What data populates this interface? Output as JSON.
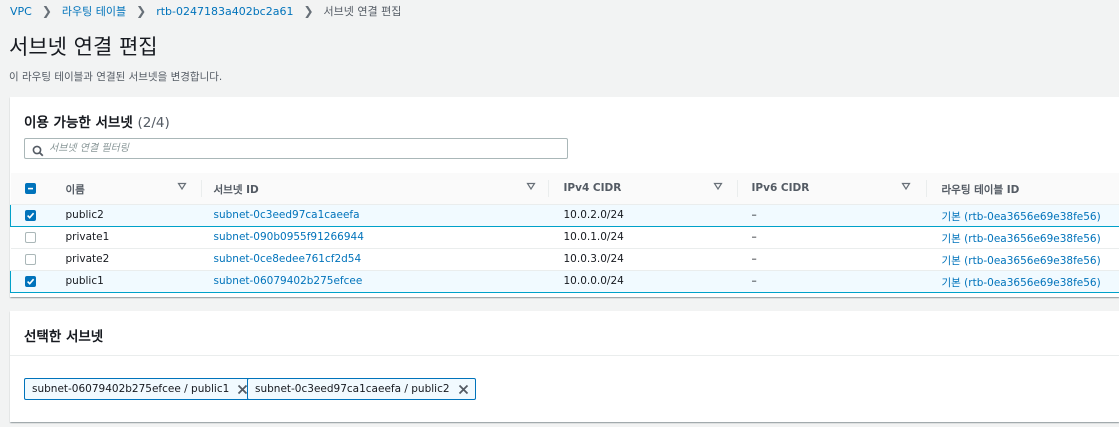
{
  "breadcrumb": {
    "items": [
      "VPC",
      "라우팅 테이블",
      "rtb-0247183a402bc2a61"
    ],
    "current": "서브넷 연결 편집"
  },
  "page": {
    "title": "서브넷 연결 편집",
    "description": "이 라우팅 테이블과 연결된 서브넷을 변경합니다."
  },
  "available": {
    "title": "이용 가능한 서브넷",
    "count": "(2/4)",
    "filter_placeholder": "서브넷 연결 필터링",
    "columns": [
      "이름",
      "서브넷 ID",
      "IPv4 CIDR",
      "IPv6 CIDR",
      "라우팅 테이블 ID"
    ],
    "rows": [
      {
        "checked": true,
        "name": "public2",
        "subnet_id": "subnet-0c3eed97ca1caeefa",
        "ipv4": "10.0.2.0/24",
        "ipv6": "–",
        "route_table": "기본 (rtb-0ea3656e69e38fe56)"
      },
      {
        "checked": false,
        "name": "private1",
        "subnet_id": "subnet-090b0955f91266944",
        "ipv4": "10.0.1.0/24",
        "ipv6": "–",
        "route_table": "기본 (rtb-0ea3656e69e38fe56)"
      },
      {
        "checked": false,
        "name": "private2",
        "subnet_id": "subnet-0ce8edee761cf2d54",
        "ipv4": "10.0.3.0/24",
        "ipv6": "–",
        "route_table": "기본 (rtb-0ea3656e69e38fe56)"
      },
      {
        "checked": true,
        "name": "public1",
        "subnet_id": "subnet-06079402b275efcee",
        "ipv4": "10.0.0.0/24",
        "ipv6": "–",
        "route_table": "기본 (rtb-0ea3656e69e38fe56)"
      }
    ]
  },
  "selected": {
    "title": "선택한 서브넷",
    "tokens": [
      "subnet-06079402b275efcee / public1",
      "subnet-0c3eed97ca1caeefa / public2"
    ]
  },
  "colors": {
    "accent": "#0073bb",
    "selected_border": "#00a1c9",
    "selected_bg": "#f1faff"
  },
  "icons": {
    "search": "search-icon",
    "sort": "caret-down-icon",
    "remove": "close-icon",
    "breadcrumb_sep": "chevron-right-icon"
  }
}
